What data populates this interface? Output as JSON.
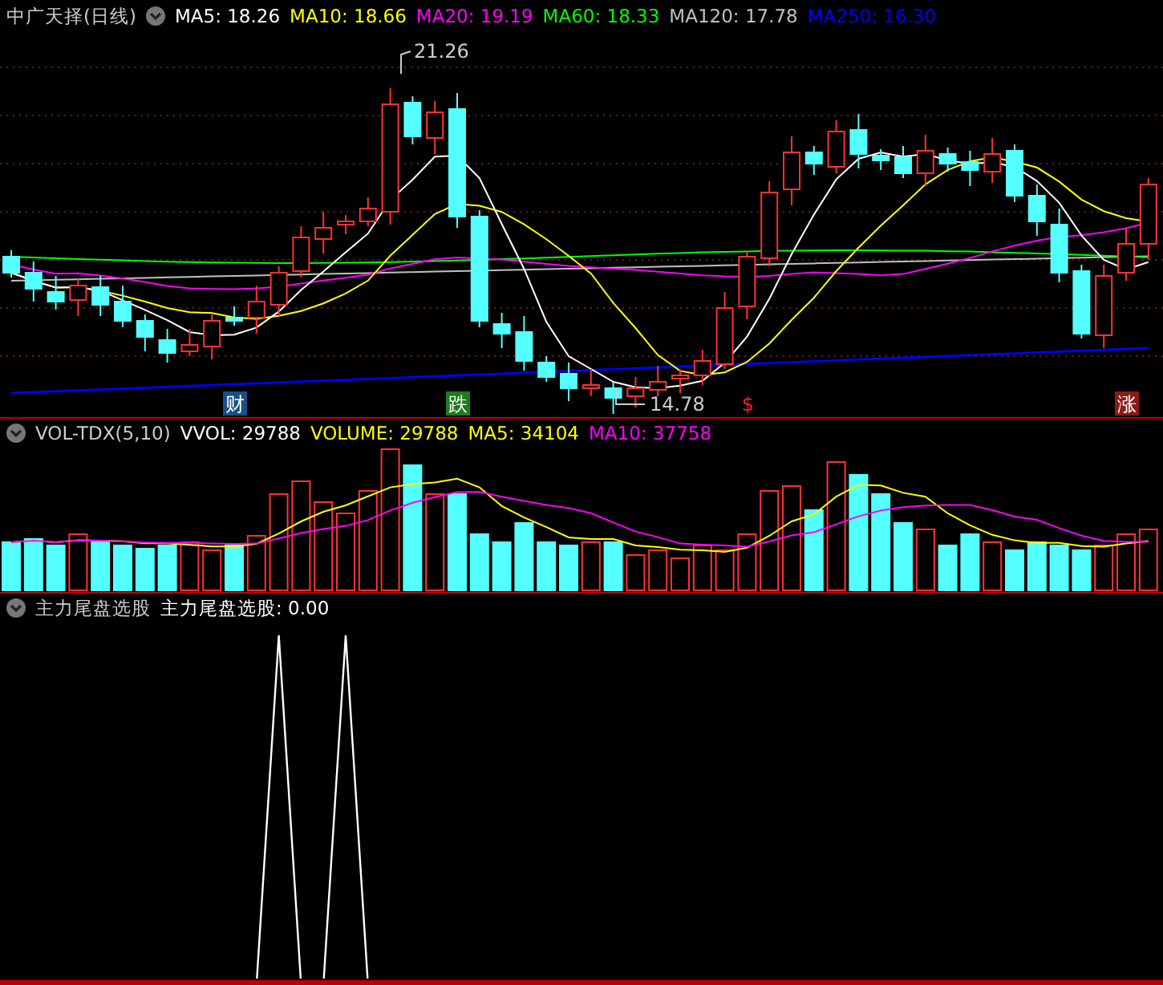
{
  "price_panel": {
    "title": "中广天择(日线)",
    "indicators": [
      {
        "label": "MA5: 18.26",
        "color": "#ffffff"
      },
      {
        "label": "MA10: 18.66",
        "color": "#ffff00"
      },
      {
        "label": "MA20: 19.19",
        "color": "#ff00ff"
      },
      {
        "label": "MA60: 18.33",
        "color": "#00ff00"
      },
      {
        "label": "MA120: 17.78",
        "color": "#c0c0c0"
      },
      {
        "label": "MA250: 16.30",
        "color": "#0000ff"
      }
    ],
    "high_label": "21.26",
    "low_label": "14.78",
    "events": [
      {
        "label": "财",
        "color": "#1a4f8a"
      },
      {
        "label": "跌",
        "color": "#1f7a1f"
      },
      {
        "label": "$",
        "color": "#ff2020"
      },
      {
        "label": "涨",
        "color": "#8b1a1a"
      }
    ]
  },
  "volume_panel": {
    "title": "VOL-TDX(5,10)",
    "indicators": [
      {
        "label": "VVOL: 29788",
        "color": "#ffffff"
      },
      {
        "label": "VOLUME: 29788",
        "color": "#ffff00"
      },
      {
        "label": "MA5: 34104",
        "color": "#ffff00"
      },
      {
        "label": "MA10: 37758",
        "color": "#ff00ff"
      }
    ]
  },
  "signal_panel": {
    "title": "主力尾盘选股",
    "indicators": [
      {
        "label": "主力尾盘选股: 0.00",
        "color": "#ffffff"
      }
    ]
  }
}
